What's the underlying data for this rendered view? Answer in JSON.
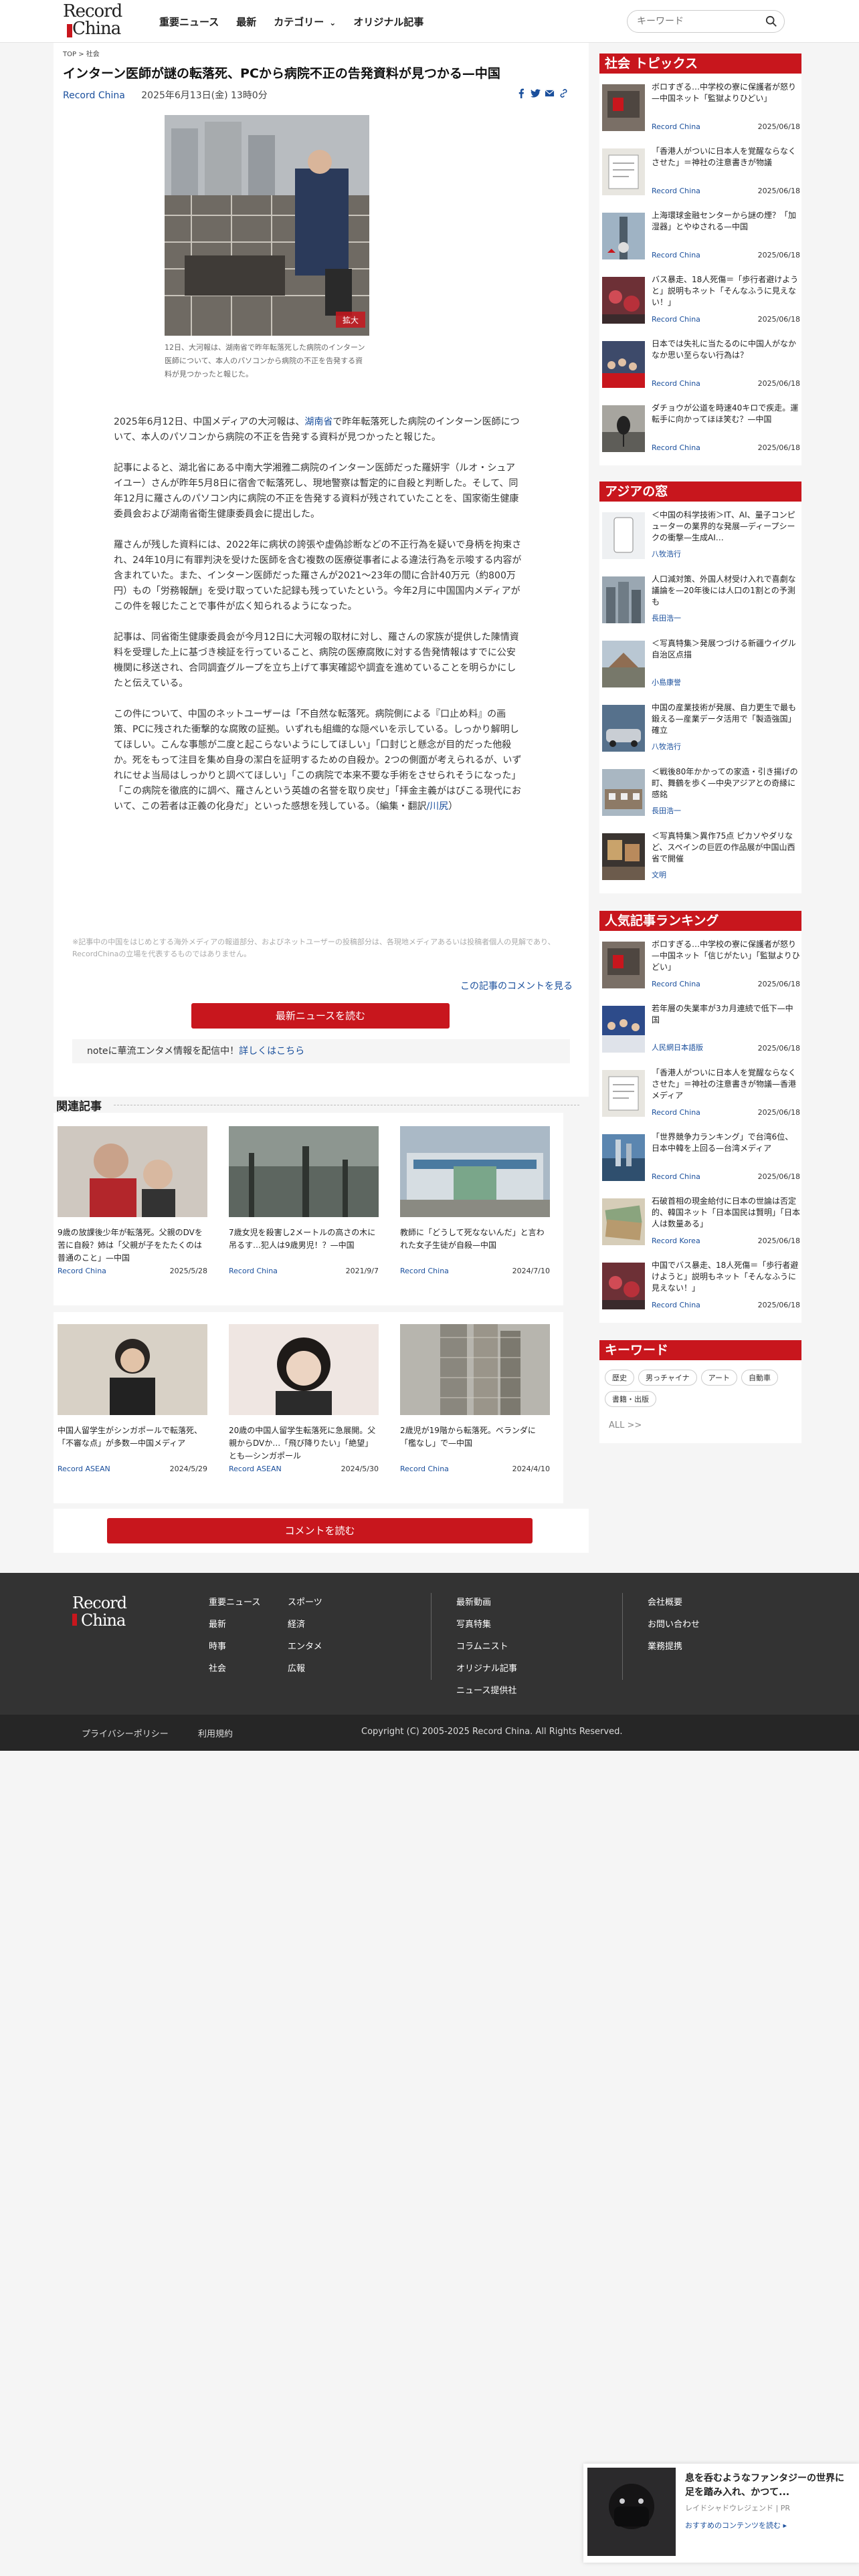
{
  "header": {
    "logo_top": "Record",
    "logo_bottom": "China",
    "nav": [
      "重要ニュース",
      "最新",
      "カテゴリー",
      "オリジナル記事"
    ],
    "search_placeholder": "キーワード"
  },
  "article": {
    "breadcrumb": "TOP > 社会",
    "title": "インターン医師が謎の転落死、PCから病院不正の告発資料が見つかる—中国",
    "source": "Record China",
    "date": "2025年6月13日(金) 13時0分",
    "photo_badge": "拡大",
    "caption": "12日、大河報は、湖南省で昨年転落死した病院のインターン医師について、本人のパソコンから病院の不正を告発する資料が見つかったと報じた。",
    "p1_pre": "2025年6月12日、中国メディアの大河報は、",
    "p1_link": "湖南省",
    "p1_post": "で昨年転落死した病院のインターン医師について、本人のパソコンから病院の不正を告発する資料が見つかったと報じた。",
    "p2": "記事によると、湖北省にある中南大学湘雅二病院のインターン医師だった羅妍宇（ルオ・シュアイユー）さんが昨年5月8日に宿舎で転落死し、現地警察は暫定的に自殺と判断した。そして、同年12月に羅さんのパソコン内に病院の不正を告発する資料が残されていたことを、国家衛生健康委員会および湖南省衛生健康委員会に提出した。",
    "p3": "羅さんが残した資料には、2022年に病状の誇張や虚偽診断などの不正行為を疑いで身柄を拘束され、24年10月に有罪判決を受けた医師を含む複数の医療従事者による違法行為を示唆する内容が含まれていた。また、インターン医師だった羅さんが2021～23年の間に合計40万元（約800万円）もの「労務報酬」を受け取っていた記録も残っていたという。今年2月に中国国内メディアがこの件を報じたことで事件が広く知られるようになった。",
    "p4": "記事は、同省衛生健康委員会が今月12日に大河報の取材に対し、羅さんの家族が提供した陳情資料を受理した上に基づき検証を行っていること、病院の医療腐敗に対する告発情報はすでに公安機関に移送され、合同調査グループを立ち上げて事実確認や調査を進めていることを明らかにしたと伝えている。",
    "p5_pre": "この件について、中国のネットユーザーは「不自然な転落死。病院側による『口止め料』の画策、PCに残された衝撃的な腐敗の証拠。いずれも組織的な隠ぺいを示している。しっかり解明してほしい。こんな事態が二度と起こらないようにしてほしい」「口封じと懸念が目的だった他殺か。死をもって注目を集め自身の潔白を証明するための自殺か。2つの側面が考えられるが、いずれにせよ当局はしっかりと調べてほしい」「この病院で本来不要な手術をさせられそうになった」「この病院を徹底的に調べ、羅さんという英雄の名誉を取り戻せ」「拝金主義がはびこる現代において、この若者は正義の化身だ」といった感想を残している。（編集・翻訳",
    "p5_link": "/川尻",
    "p5_post": "）",
    "disclaimer": "※記事中の中国をはじめとする海外メディアの報道部分、およびネットユーザーの投稿部分は、各現地メディアあるいは投稿者個人の見解であり、RecordChinaの立場を代表するものではありません。",
    "comment_link": "この記事のコメントを見る",
    "latest_button": "最新ニュースを読む",
    "note_text": "noteに華流エンタメ情報を配信中！",
    "note_link": "詳しくはこちら"
  },
  "related": {
    "heading": "関連記事",
    "items": [
      {
        "title": "9歳の放課後少年が転落死。父親のDVを苦に自殺？姉は「父親が子をたたくのは普通のこと」—中国",
        "source": "Record China",
        "date": "2025/5/28"
      },
      {
        "title": "7歳女児を殺害し2メートルの高さの木に吊るす…犯人は9歳男児！？—中国",
        "source": "Record China",
        "date": "2021/9/7"
      },
      {
        "title": "教師に「どうして死なないんだ」と言われた女子生徒が自殺—中国",
        "source": "Record China",
        "date": "2024/7/10"
      },
      {
        "title": "中国人留学生がシンガポールで転落死、「不審な点」が多数—中国メディア",
        "source": "Record ASEAN",
        "date": "2024/5/29"
      },
      {
        "title": "20歳の中国人留学生転落死に急展開。父親からDVか…「飛び降りたい」「絶望」とも—シンガポール",
        "source": "Record ASEAN",
        "date": "2024/5/30"
      },
      {
        "title": "2歳児が19階から転落死。ベランダに「檻なし」で—中国",
        "source": "Record China",
        "date": "2024/4/10"
      }
    ],
    "comment_button": "コメントを読む"
  },
  "sidebar": {
    "topics_heading": "社会 トピックス",
    "topics": [
      {
        "title": "ボロすぎる…中学校の寮に保護者が怒り—中国ネット「監獄よりひどい」",
        "source": "Record China",
        "date": "2025/06/18"
      },
      {
        "title": "「香港人がついに日本人を覚醒ならなくさせた」＝神社の注意書きが物議",
        "source": "Record China",
        "date": "2025/06/18"
      },
      {
        "title": "上海環球金融センターから謎の煙？「加湿器」とやゆされる—中国",
        "source": "Record China",
        "date": "2025/06/18"
      },
      {
        "title": "バス暴走、18人死傷＝「歩行者避けようと」説明もネット「そんなふうに見えない！」",
        "source": "Record China",
        "date": "2025/06/18"
      },
      {
        "title": "日本では失礼に当たるのに中国人がなかなか思い至らない行為は？",
        "source": "Record China",
        "date": "2025/06/18"
      },
      {
        "title": "ダチョウが公道を時速40キロで疾走。運転手に向かってほほ笑む？—中国",
        "source": "Record China",
        "date": "2025/06/18"
      }
    ],
    "asia_heading": "アジアの窓",
    "asia": [
      {
        "title": "＜中国の科学技術＞IT、AI、量子コンピューターの業界的な発展—ディープシークの衝撃—生成AI…",
        "source": "八牧浩行"
      },
      {
        "title": "人口減対策、外国人材受け入れで喜劇な議論を—20年後には人口の1割との予測も",
        "source": "長田浩一"
      },
      {
        "title": "＜写真特集＞発展つづける新疆ウイグル自治区点描",
        "source": "小島康誉"
      },
      {
        "title": "中国の産業技術が発展、自力更生で最も鍛える—産業データ活用で「製造強国」確立",
        "source": "八牧浩行"
      },
      {
        "title": "＜戦後80年かかっての家造・引き揚げの町、舞鶴を歩く—中央アジアとの奇縁に感銘",
        "source": "長田浩一"
      },
      {
        "title": "＜写真特集＞異作75点 ピカソやダリなど、スペインの巨匠の作品展が中国山西省で開催",
        "source": "文明"
      }
    ],
    "ranking_heading": "人気記事ランキング",
    "ranking": [
      {
        "title": "ボロすぎる…中学校の寮に保護者が怒り—中国ネット「信じがたい」「監獄よりひどい」",
        "source": "Record China",
        "date": "2025/06/18"
      },
      {
        "title": "若年層の失業率が3カ月連続で低下—中国",
        "source": "人民網日本語版",
        "date": "2025/06/18"
      },
      {
        "title": "「香港人がついに日本人を覚醒ならなくさせた」＝神社の注意書きが物議—香港メディア",
        "source": "Record China",
        "date": "2025/06/18"
      },
      {
        "title": "「世界競争力ランキング」で台湾6位、日本中韓を上回る—台湾メディア",
        "source": "Record China",
        "date": "2025/06/18"
      },
      {
        "title": "石破首相の現金給付に日本の世論は否定的、韓国ネット「日本国民は賢明」「日本人は数量ある」",
        "source": "Record Korea",
        "date": "2025/06/18"
      },
      {
        "title": "中国でバス暴走、18人死傷＝「歩行者避けようと」説明もネット「そんなふうに見えない！」",
        "source": "Record China",
        "date": "2025/06/18"
      }
    ],
    "keyword_heading": "キーワード",
    "keywords": [
      "歴史",
      "男っチャイナ",
      "アート",
      "自動車",
      "書籍・出版"
    ],
    "keyword_all": "ALL >>"
  },
  "footer": {
    "logo_top": "Record",
    "logo_bottom": "China",
    "col1": [
      "重要ニュース",
      "最新",
      "時事",
      "社会"
    ],
    "col2": [
      "スポーツ",
      "経済",
      "エンタメ",
      "広報"
    ],
    "col3": [
      "最新動画",
      "写真特集",
      "コラムニスト",
      "オリジナル記事",
      "ニュース提供社"
    ],
    "col4": [
      "会社概要",
      "お問い合わせ",
      "業務提携"
    ],
    "privacy": "プライバシーポリシー",
    "terms": "利用規約",
    "copyright": "Copyright (C) 2005-2025 Record China. All Rights Reserved."
  },
  "ad": {
    "title": "息を呑むようなファンタジーの世界に足を踏み入れ、かつて...",
    "sponsor": "レイドシャドウレジェンド | PR",
    "cta": "おすすめのコンテンツを読む ▸"
  }
}
